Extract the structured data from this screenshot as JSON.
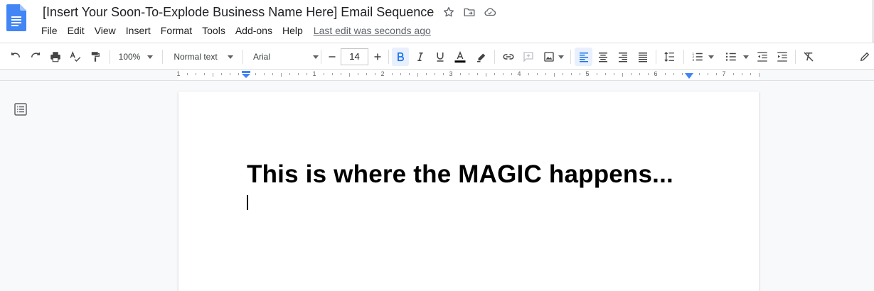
{
  "document": {
    "title": "[Insert Your Soon-To-Explode Business Name Here] Email Sequence",
    "last_edit": "Last edit was seconds ago",
    "heading": "This is where the MAGIC happens..."
  },
  "menu": [
    "File",
    "Edit",
    "View",
    "Insert",
    "Format",
    "Tools",
    "Add-ons",
    "Help"
  ],
  "toolbar": {
    "zoom": "100%",
    "style": "Normal text",
    "font": "Arial",
    "font_size": "14",
    "bold_active": true,
    "alignment": "left",
    "text_color": "#000000"
  },
  "ruler": {
    "labels": [
      "1",
      "1",
      "2",
      "3",
      "4",
      "5",
      "6",
      "7"
    ]
  },
  "colors": {
    "accent": "#1a73e8",
    "active_bg": "#e8f0fe",
    "doc_icon": "#4285f4"
  },
  "icons": {
    "header": [
      "google-docs-icon",
      "star-icon",
      "move-to-folder-icon",
      "cloud-saved-icon"
    ],
    "toolbar": [
      "undo-icon",
      "redo-icon",
      "print-icon",
      "spellcheck-icon",
      "paint-format-icon",
      "bold-icon",
      "italic-icon",
      "underline-icon",
      "text-color-icon",
      "highlight-icon",
      "link-icon",
      "comment-icon",
      "image-icon",
      "align-left-icon",
      "align-center-icon",
      "align-right-icon",
      "justify-icon",
      "line-spacing-icon",
      "numbered-list-icon",
      "bulleted-list-icon",
      "decrease-indent-icon",
      "increase-indent-icon",
      "clear-formatting-icon",
      "editing-mode-icon"
    ],
    "sidebar": [
      "document-outline-icon"
    ]
  }
}
